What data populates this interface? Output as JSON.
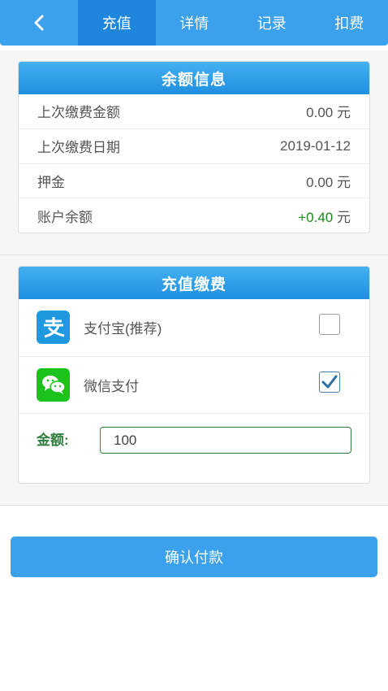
{
  "nav": {
    "back_icon": "chevron-left-icon",
    "tabs": [
      {
        "label": "充值",
        "active": true
      },
      {
        "label": "详情",
        "active": false
      },
      {
        "label": "记录",
        "active": false
      },
      {
        "label": "扣费",
        "active": false
      }
    ]
  },
  "balance": {
    "title": "余额信息",
    "rows": [
      {
        "label": "上次缴费金额",
        "value": "0.00",
        "unit": "元"
      },
      {
        "label": "上次缴费日期",
        "value": "2019-01-12",
        "unit": ""
      },
      {
        "label": "押金",
        "value": "0.00",
        "unit": "元"
      },
      {
        "label": "账户余额",
        "value": "+0.40",
        "unit": "元"
      }
    ]
  },
  "recharge": {
    "title": "充值缴费",
    "methods": [
      {
        "label": "支付宝(推荐)",
        "icon": "alipay-icon",
        "checked": false
      },
      {
        "label": "微信支付",
        "icon": "wechat-icon",
        "checked": true
      }
    ],
    "amount_label": "金额:",
    "amount_value": "100"
  },
  "confirm_label": "确认付款",
  "colors": {
    "primary": "#3ba1ec",
    "tab_active": "#1f86dd",
    "positive": "#1c8a1c",
    "amount_green": "#2f7d3e",
    "alipay": "#1e98df",
    "wechat": "#1bc31c"
  }
}
